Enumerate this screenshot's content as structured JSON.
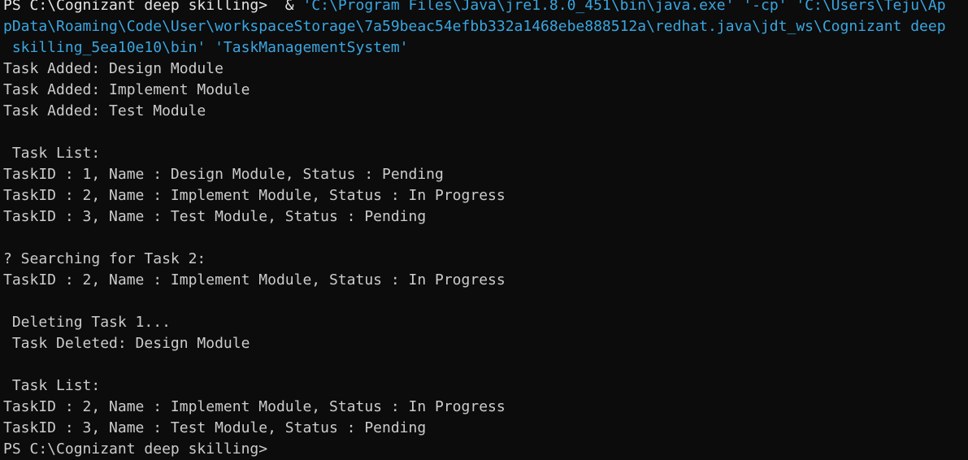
{
  "terminal": {
    "command": {
      "line1_prompt": "PS C:\\Cognizant deep skilling>  & ",
      "line1_arg": "'C:\\Program Files\\Java\\jre1.8.0_451\\bin\\java.exe' '-cp' 'C:\\Users\\Teju\\Ap",
      "line2": "pData\\Roaming\\Code\\User\\workspaceStorage\\7a59beac54efbb332a1468ebe888512a\\redhat.java\\jdt_ws\\Cognizant deep",
      "line3": " skilling_5ea10e10\\bin' 'TaskManagementSystem'"
    },
    "output": {
      "added1": "Task Added: Design Module",
      "added2": "Task Added: Implement Module",
      "added3": "Task Added: Test Module",
      "list_header1": " Task List:",
      "list1_row1": "TaskID : 1, Name : Design Module, Status : Pending",
      "list1_row2": "TaskID : 2, Name : Implement Module, Status : In Progress",
      "list1_row3": "TaskID : 3, Name : Test Module, Status : Pending",
      "search_header": "? Searching for Task 2:",
      "search_result": "TaskID : 2, Name : Implement Module, Status : In Progress",
      "delete_header": " Deleting Task 1...",
      "delete_result": " Task Deleted: Design Module",
      "list_header2": " Task List:",
      "list2_row1": "TaskID : 2, Name : Implement Module, Status : In Progress",
      "list2_row2": "TaskID : 3, Name : Test Module, Status : Pending"
    },
    "final_prompt": "PS C:\\Cognizant deep skilling>"
  },
  "colors": {
    "background": "#0c0c0c",
    "text": "#cccccc",
    "argument": "#3aa6e0"
  }
}
